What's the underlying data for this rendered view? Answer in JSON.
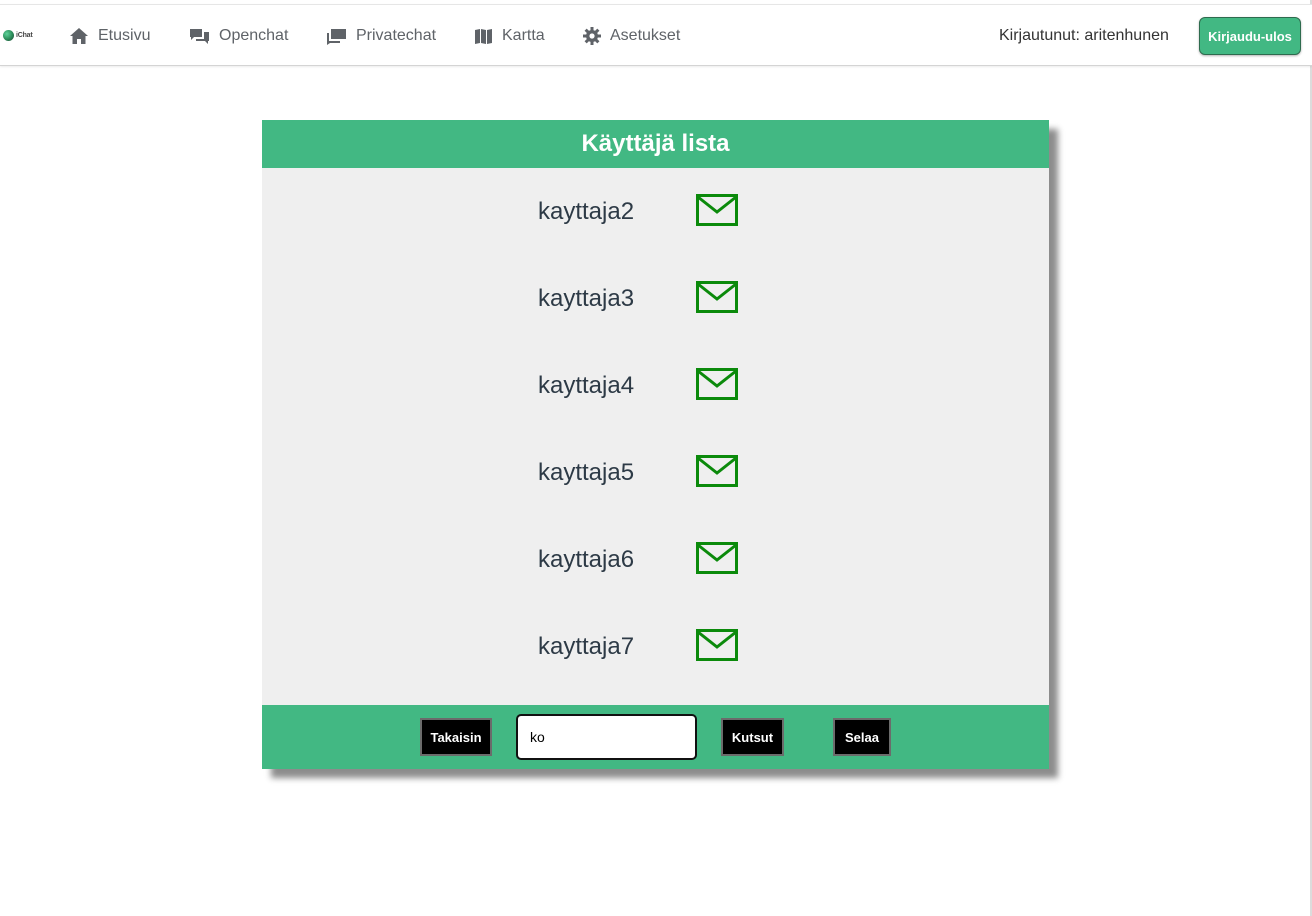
{
  "app": {
    "logo_text": "iChat"
  },
  "nav": {
    "items": [
      {
        "label": "Etusivu",
        "icon": "home-icon"
      },
      {
        "label": "Openchat",
        "icon": "chat-bubbles-icon"
      },
      {
        "label": "Privatechat",
        "icon": "private-chat-icon"
      },
      {
        "label": "Kartta",
        "icon": "map-icon"
      },
      {
        "label": "Asetukset",
        "icon": "gear-icon"
      }
    ],
    "logged_in_text": "Kirjautunut: aritenhunen",
    "logout_label": "Kirjaudu-ulos"
  },
  "card": {
    "title": "Käyttäjä lista",
    "users": [
      {
        "name": "kayttaja2",
        "icon": "mail-icon"
      },
      {
        "name": "kayttaja3",
        "icon": "mail-icon"
      },
      {
        "name": "kayttaja4",
        "icon": "mail-icon"
      },
      {
        "name": "kayttaja5",
        "icon": "mail-icon"
      },
      {
        "name": "kayttaja6",
        "icon": "mail-icon"
      },
      {
        "name": "kayttaja7",
        "icon": "mail-icon"
      }
    ],
    "footer": {
      "back_label": "Takaisin",
      "search_value": "ko",
      "invites_label": "Kutsut",
      "browse_label": "Selaa"
    }
  },
  "colors": {
    "accent": "#42b883",
    "mail_icon": "#0b8a0b",
    "card_bg": "#efefef",
    "button_bg": "#000000"
  }
}
